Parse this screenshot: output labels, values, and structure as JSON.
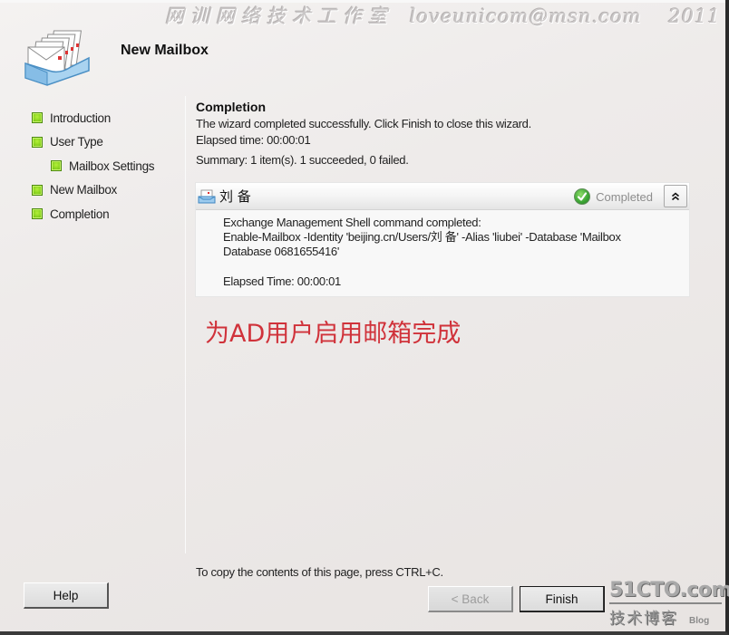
{
  "watermark": {
    "chinese": "网训网络技术工作室",
    "email": "loveunicom@msn.com",
    "year": "2011"
  },
  "header": {
    "icon": "mailbox-tray-icon",
    "title": "New Mailbox"
  },
  "steps": [
    {
      "label": "Introduction",
      "icon": "step-complete-icon",
      "indent": false
    },
    {
      "label": "User Type",
      "icon": "step-complete-icon",
      "indent": false
    },
    {
      "label": "Mailbox Settings",
      "icon": "step-complete-icon",
      "indent": true
    },
    {
      "label": "New Mailbox",
      "icon": "step-complete-icon",
      "indent": false
    },
    {
      "label": "Completion",
      "icon": "step-complete-icon",
      "indent": false
    }
  ],
  "content": {
    "section_title": "Completion",
    "message": "The wizard completed successfully. Click Finish to close this wizard.",
    "elapsed": "Elapsed time: 00:00:01",
    "summary": "Summary: 1 item(s). 1 succeeded, 0 failed."
  },
  "result": {
    "name": "刘 备",
    "status": "Completed",
    "status_icon": "check-circle-icon",
    "collapse_icon": "double-chevron-up-icon",
    "body_line1": "Exchange Management Shell command completed:",
    "body_line2": "Enable-Mailbox -Identity 'beijing.cn/Users/刘 备' -Alias 'liubei' -Database 'Mailbox",
    "body_line3": "Database 0681655416'",
    "body_elapsed": "Elapsed Time: 00:00:01"
  },
  "annotation": "为AD用户启用邮箱完成",
  "footer": {
    "copy_hint": "To copy the contents of this page, press CTRL+C.",
    "help_label": "Help",
    "back_label": "< Back",
    "finish_label": "Finish"
  },
  "logo_watermark": {
    "big": "51CTO.com",
    "cn": "技术博客",
    "blog": "Blog"
  },
  "colors": {
    "annotation": "#d0323a",
    "step_bullet": "#86d11c",
    "status_text": "#8d8d8d"
  }
}
